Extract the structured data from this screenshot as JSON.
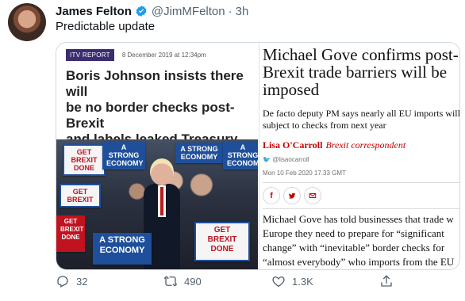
{
  "tweet": {
    "display_name": "James Felton",
    "handle": "@JimMFelton",
    "separator": "·",
    "timestamp": "3h",
    "text": "Predictable update"
  },
  "itv_article": {
    "tag": "ITV REPORT",
    "date": "8 December 2019 at 12:34pm",
    "headline": "Boris Johnson insists there will\nbe no border checks post-Brexit\nand labels leaked Treasury\ndocument 'wrong'",
    "signs": [
      "GET BREXIT DONE",
      "A STRONG ECONOMY",
      "A STRONG ECONOMY",
      "A STRONG ECONOMY",
      "GET BREXIT DONE",
      "A STRONG ECONOMY",
      "GET BREXIT DONE",
      "GET BREXIT"
    ]
  },
  "guardian_article": {
    "headline": "Michael Gove confirms post-\nBrexit trade barriers will be\nimposed",
    "standfirst": "De facto deputy PM says nearly all EU imports will\nsubject to checks from next year",
    "author": "Lisa O'Carroll",
    "role": "Brexit correspondent",
    "twitter": "@lisaocarroll",
    "date": "Mon 10 Feb 2020 17.33 GMT",
    "body": "Michael Gove has told businesses that trade w\nEurope they need to prepare for “significant\nchange” with “inevitable” border checks for\n“almost everybody” who imports from the EU"
  },
  "actions": {
    "reply_count": "32",
    "retweet_count": "490",
    "like_count": "1.3K"
  },
  "colors": {
    "verified": "#1d9bf0",
    "itv_tag": "#3c2d70",
    "guardian_red": "#c70000",
    "muted": "#536471"
  }
}
